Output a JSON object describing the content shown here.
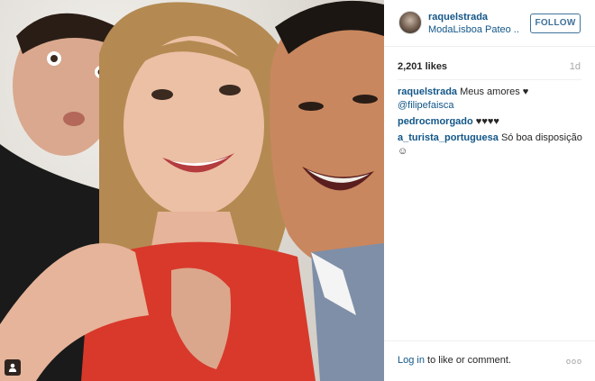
{
  "post": {
    "username": "raquelstrada",
    "location": "ModaLisboa Pateo ...",
    "follow_label": "FOLLOW",
    "likes": "2,201 likes",
    "time": "1d"
  },
  "comments": [
    {
      "user": "raquelstrada",
      "text": "Meus amores ♥",
      "mention": "@filipefaisca"
    },
    {
      "user": "pedrocmorgado",
      "text": "♥♥♥♥",
      "mention": ""
    },
    {
      "user": "a_turista_portuguesa",
      "text": "Só boa disposição ☺",
      "mention": ""
    }
  ],
  "footer": {
    "login_link": "Log in",
    "login_rest": " to like or comment.",
    "more_glyph": "ooo"
  },
  "colors": {
    "link": "#125688",
    "follow": "#3f729b",
    "muted": "#a5a7aa"
  }
}
